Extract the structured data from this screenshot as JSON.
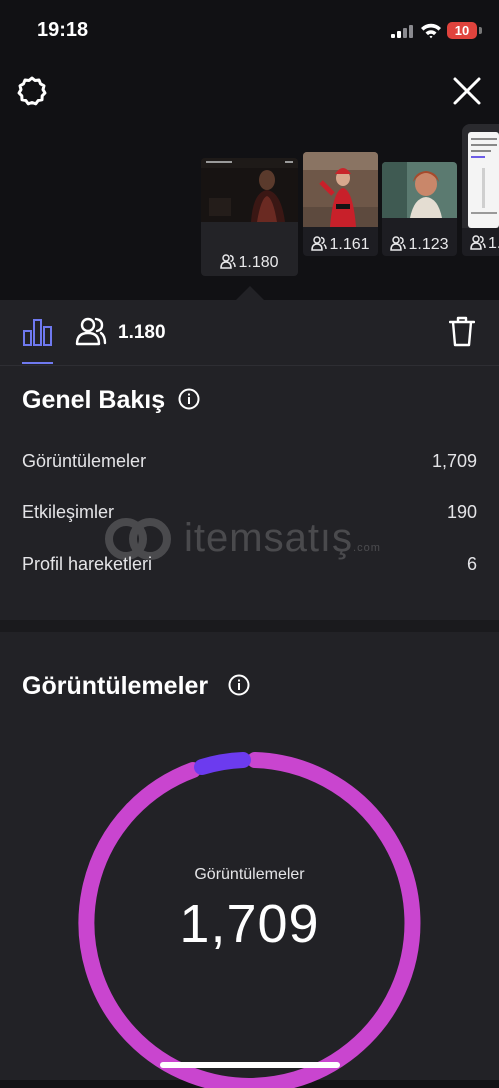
{
  "status_bar": {
    "time": "19:18",
    "battery": "10"
  },
  "stories": [
    {
      "viewers": "1.180",
      "selected": true
    },
    {
      "viewers": "1.161"
    },
    {
      "viewers": "1.123"
    },
    {
      "viewers": "1."
    }
  ],
  "tabs": {
    "viewer_count": "1.180"
  },
  "overview": {
    "title": "Genel Bakış",
    "rows": [
      {
        "label": "Görüntülemeler",
        "value": "1,709"
      },
      {
        "label": "Etkileşimler",
        "value": "190"
      },
      {
        "label": "Profil hareketleri",
        "value": "6"
      }
    ]
  },
  "views": {
    "title": "Görüntülemeler",
    "donut_label": "Görüntülemeler",
    "donut_value": "1,709",
    "donut_colors": {
      "main": "#c945cf",
      "secondary": "#6c3bef"
    }
  },
  "watermark": {
    "brand": "itemsatış",
    "domain": ".com"
  }
}
